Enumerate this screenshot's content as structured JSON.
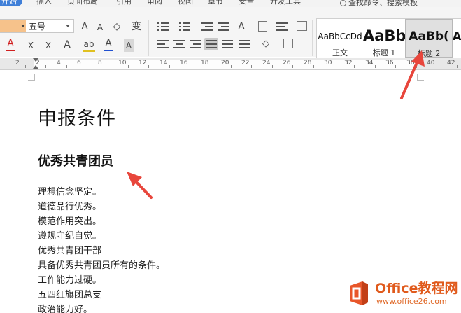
{
  "menu": {
    "tabs": [
      "开始",
      "插入",
      "页面布局",
      "引用",
      "审阅",
      "视图",
      "章节",
      "安全",
      "开发工具"
    ],
    "search_text": "查找命令、搜索模板"
  },
  "toolbar": {
    "font_size": "五号",
    "grow_font": "A",
    "shrink_font": "A",
    "clear_format": "◇",
    "phonetic": "变",
    "font_color_a": "A",
    "superscript": "X",
    "subscript": "X",
    "text_effect": "A",
    "highlight": "ab",
    "font_color_b": "A",
    "char_shading": "A",
    "text_direction": "A"
  },
  "styles": {
    "items": [
      {
        "sample": "AaBbCcDd",
        "caption": "正文"
      },
      {
        "sample": "AaBb",
        "caption": "标题 1"
      },
      {
        "sample": "AaBb(",
        "caption": "标题 2"
      },
      {
        "sample": "Aa",
        "caption": ""
      }
    ]
  },
  "ruler": {
    "numbers": [
      "2",
      "2",
      "4",
      "6",
      "8",
      "10",
      "12",
      "14",
      "16",
      "18",
      "20",
      "22",
      "24",
      "26",
      "28",
      "30",
      "32",
      "34",
      "36",
      "38",
      "40",
      "42"
    ]
  },
  "document": {
    "heading1": "申报条件",
    "heading2": "优秀共青团员",
    "lines": [
      "理想信念坚定。",
      "道德品行优秀。",
      "模范作用突出。",
      "遵规守纪自觉。",
      "优秀共青团干部",
      "具备优秀共青团员所有的条件。",
      "工作能力过硬。",
      "五四红旗团总支",
      "政治能力好。"
    ]
  },
  "watermark": {
    "title": "Office教程网",
    "url": "www.office26.com"
  },
  "colors": {
    "accent_tab": "#3f7fd8",
    "annotation_arrow": "#e8463c",
    "watermark": "#e05a1c"
  }
}
